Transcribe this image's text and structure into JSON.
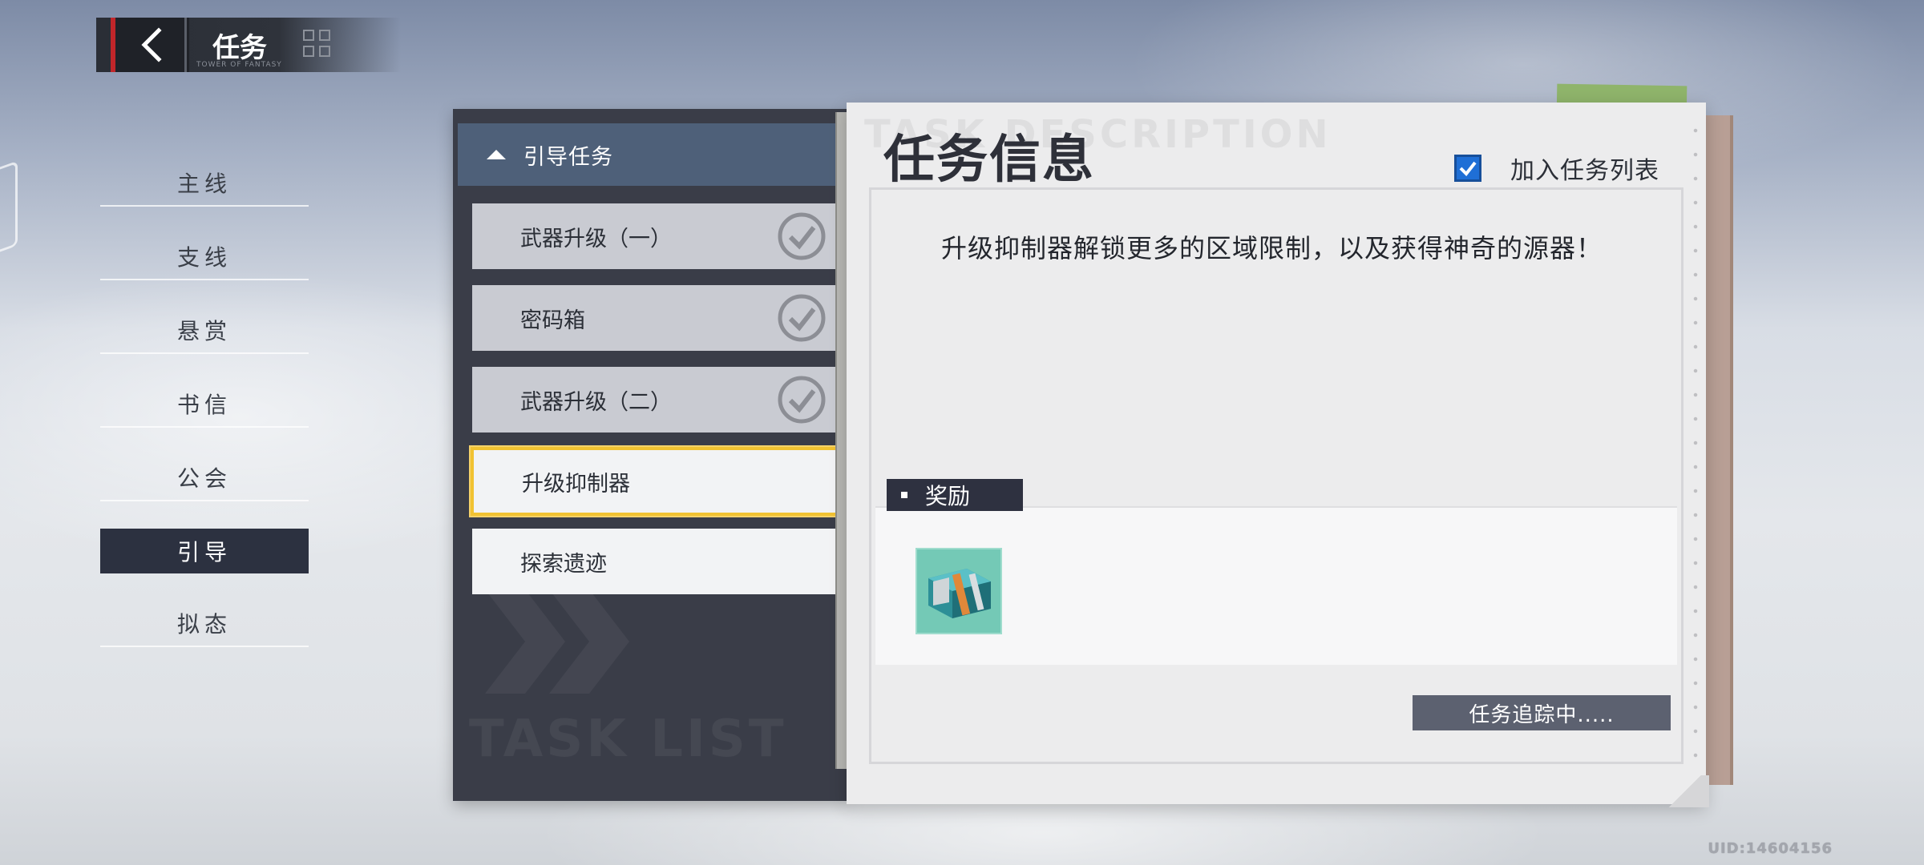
{
  "header": {
    "title": "任务",
    "subtitle": "TOWER OF FANTASY"
  },
  "nav": {
    "items": [
      {
        "label": "主线",
        "active": false
      },
      {
        "label": "支线",
        "active": false
      },
      {
        "label": "悬赏",
        "active": false
      },
      {
        "label": "书信",
        "active": false
      },
      {
        "label": "公会",
        "active": false
      },
      {
        "label": "引导",
        "active": true
      },
      {
        "label": "拟态",
        "active": false
      }
    ]
  },
  "task_list": {
    "category_label": "引导任务",
    "watermark": "TASK LIST",
    "tasks": [
      {
        "label": "武器升级（一）",
        "completed": true
      },
      {
        "label": "密码箱",
        "completed": true
      },
      {
        "label": "武器升级（二）",
        "completed": true
      },
      {
        "label": "升级抑制器",
        "completed": false,
        "selected": true
      },
      {
        "label": "探索遗迹",
        "completed": false
      }
    ]
  },
  "info": {
    "watermark": "TASK DESCRIPTION",
    "title": "任务信息",
    "track_toggle_label": "加入任务列表",
    "track_toggle_checked": true,
    "description": "升级抑制器解锁更多的区域限制，以及获得神奇的源器！",
    "reward_label": "奖励",
    "reward_items": [
      {
        "icon": "supply-box-icon"
      }
    ],
    "tracking_button": "任务追踪中....."
  },
  "uid": "UID:14604156",
  "colors": {
    "accent_red": "#c0262a",
    "selected_border": "#f1c232",
    "checkbox_blue": "#1f6fd6",
    "category_header": "#4e6079"
  }
}
